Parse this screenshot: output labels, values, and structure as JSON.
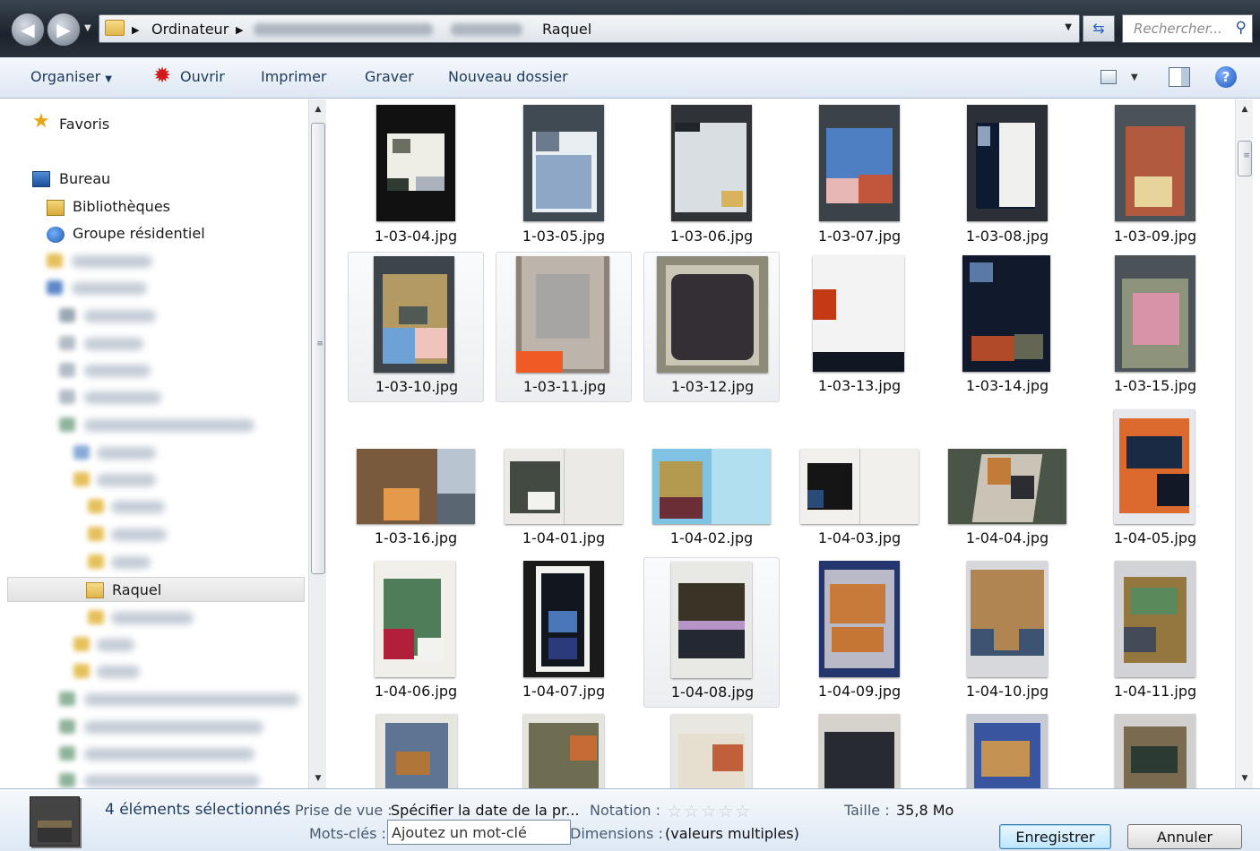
{
  "address": {
    "crumbs": [
      "Ordinateur",
      "Raquel"
    ],
    "search_placeholder": "Rechercher..."
  },
  "toolbar": {
    "organize": "Organiser",
    "open": "Ouvrir",
    "print": "Imprimer",
    "burn": "Graver",
    "new_folder": "Nouveau dossier"
  },
  "sidebar": {
    "favorites": "Favoris",
    "desktop": "Bureau",
    "libraries": "Bibliothèques",
    "homegroup": "Groupe résidentiel",
    "current_folder": "Raquel"
  },
  "files": [
    {
      "name": "1-03-04.jpg",
      "selected": false
    },
    {
      "name": "1-03-05.jpg",
      "selected": false
    },
    {
      "name": "1-03-06.jpg",
      "selected": false
    },
    {
      "name": "1-03-07.jpg",
      "selected": false
    },
    {
      "name": "1-03-08.jpg",
      "selected": false
    },
    {
      "name": "1-03-09.jpg",
      "selected": false
    },
    {
      "name": "1-03-10.jpg",
      "selected": true
    },
    {
      "name": "1-03-11.jpg",
      "selected": true
    },
    {
      "name": "1-03-12.jpg",
      "selected": true
    },
    {
      "name": "1-03-13.jpg",
      "selected": false
    },
    {
      "name": "1-03-14.jpg",
      "selected": false
    },
    {
      "name": "1-03-15.jpg",
      "selected": false
    },
    {
      "name": "1-03-16.jpg",
      "selected": false
    },
    {
      "name": "1-04-01.jpg",
      "selected": false
    },
    {
      "name": "1-04-02.jpg",
      "selected": false
    },
    {
      "name": "1-04-03.jpg",
      "selected": false
    },
    {
      "name": "1-04-04.jpg",
      "selected": false
    },
    {
      "name": "1-04-05.jpg",
      "selected": false
    },
    {
      "name": "1-04-06.jpg",
      "selected": false
    },
    {
      "name": "1-04-07.jpg",
      "selected": false
    },
    {
      "name": "1-04-08.jpg",
      "selected": true
    },
    {
      "name": "1-04-09.jpg",
      "selected": false
    },
    {
      "name": "1-04-10.jpg",
      "selected": false
    },
    {
      "name": "1-04-11.jpg",
      "selected": false
    }
  ],
  "details": {
    "selection_count": "4 éléments sélectionnés",
    "date_label": "Prise de vue :",
    "date_value": "Spécifier la date de la pr...",
    "rating_label": "Notation :",
    "rating_stars": "☆☆☆☆☆",
    "size_label": "Taille :",
    "size_value": "35,8 Mo",
    "keywords_label": "Mots-clés :",
    "keywords_value": "Ajoutez un mot-clé",
    "dimensions_label": "Dimensions :",
    "dimensions_value": "(valeurs multiples)"
  },
  "buttons": {
    "save": "Enregistrer",
    "cancel": "Annuler"
  },
  "icons": {
    "back": "back-arrow-icon",
    "forward": "forward-arrow-icon",
    "open": "open-with-icon",
    "search": "magnifier-icon",
    "help": "help-icon"
  }
}
